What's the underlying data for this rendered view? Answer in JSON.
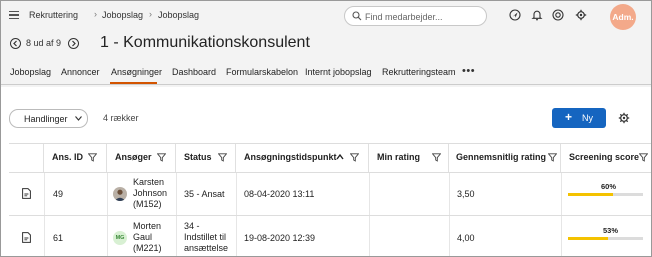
{
  "breadcrumb": [
    "Rekruttering",
    "Jobopslag",
    "Jobopslag"
  ],
  "search": {
    "placeholder": "Find medarbejder..."
  },
  "user": {
    "initials": "Adm."
  },
  "pager": {
    "text": "8 ud af 9"
  },
  "page_title": "1 - Kommunikationskonsulent",
  "tabs": [
    {
      "label": "Jobopslag"
    },
    {
      "label": "Annoncer"
    },
    {
      "label": "Ansøgninger",
      "active": true
    },
    {
      "label": "Dashboard"
    },
    {
      "label": "Formularskabelon"
    },
    {
      "label": "Internt jobopslag"
    },
    {
      "label": "Rekrutteringsteam"
    }
  ],
  "toolbar": {
    "actions_label": "Handlinger",
    "row_count": "4 rækker",
    "new_label": "Ny"
  },
  "table": {
    "headers": [
      "Ans. ID",
      "Ansøger",
      "Status",
      "Ansøgningstidspunkt",
      "Min rating",
      "Gennemsnitlig rating",
      "Screening score"
    ],
    "rows": [
      {
        "id": "49",
        "applicant": [
          "Karsten",
          "Johnson",
          "(M152)"
        ],
        "initials": "",
        "status": [
          "35 - Ansat"
        ],
        "applied_at": "08-04-2020 13:11",
        "my_rating": "",
        "avg_rating": "3,50",
        "score_label": "60%",
        "score": 0.6
      },
      {
        "id": "61",
        "applicant": [
          "Morten",
          "Gaul",
          "(M221)"
        ],
        "initials": "MG",
        "status": [
          "34 -",
          "Indstillet til",
          "ansættelse"
        ],
        "applied_at": "19-08-2020 12:39",
        "my_rating": "",
        "avg_rating": "4,00",
        "score_label": "53%",
        "score": 0.53
      }
    ]
  },
  "colors": {
    "accent": "#d35400",
    "primary": "#1565c0",
    "score_bar": "#f4c200",
    "avatar": "#f3a98a"
  }
}
